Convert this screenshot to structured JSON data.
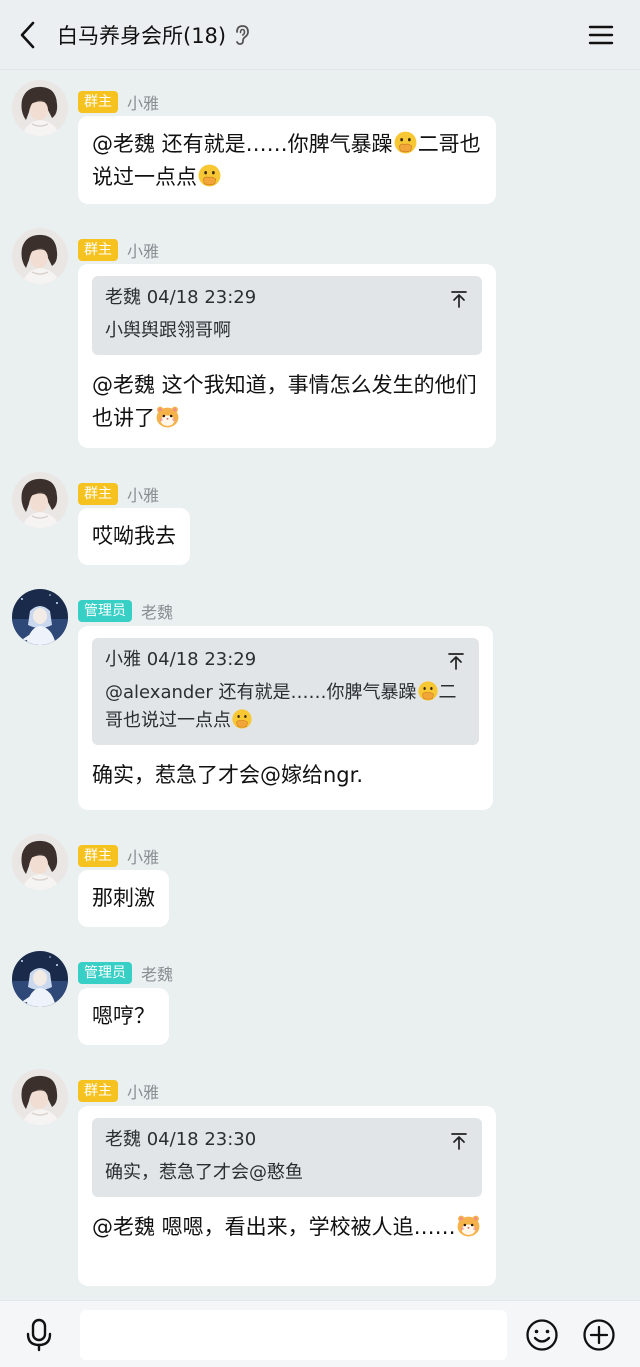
{
  "header": {
    "title": "白马养身会所(18)"
  },
  "messages": [
    {
      "sender": "小雅",
      "badge": "群主",
      "text": "@老魏 还有就是……你脾气暴躁",
      "text_emoji": "hand-over-mouth",
      "text2": "二哥也说过一点点",
      "text2_emoji": "hand-over-mouth"
    },
    {
      "sender": "小雅",
      "badge": "群主",
      "quote": {
        "author": "老魏",
        "time": "04/18 23:29",
        "text": "小舆舆跟翎哥啊"
      },
      "text": "@老魏 这个我知道，事情怎么发生的他们也讲了",
      "text_emoji": "hamster"
    },
    {
      "sender": "小雅",
      "badge": "群主",
      "text": "哎呦我去"
    },
    {
      "sender": "老魏",
      "badge": "管理员",
      "quote": {
        "author": "小雅",
        "time": "04/18 23:29",
        "text": "@alexander 还有就是……你脾气暴躁",
        "text_emoji": "hand-over-mouth",
        "text2": "二哥也说过一点点",
        "text2_emoji": "hand-over-mouth"
      },
      "text": "确实，惹急了才会@嫁给ngr."
    },
    {
      "sender": "小雅",
      "badge": "群主",
      "text": "那刺激"
    },
    {
      "sender": "老魏",
      "badge": "管理员",
      "text": "嗯哼？"
    },
    {
      "sender": "小雅",
      "badge": "群主",
      "quote": {
        "author": "老魏",
        "time": "04/18 23:30",
        "text": "确实，惹急了才会@憨鱼"
      },
      "text": "@老魏 嗯嗯，看出来，学校被人追……",
      "text_emoji": "hamster"
    }
  ],
  "input": {
    "placeholder": ""
  },
  "colors": {
    "owner_badge": "#f6c21f",
    "admin_badge": "#38cfc6",
    "background": "#eaeff0",
    "bubble": "#ffffff",
    "quote_bg": "#e2e5e8"
  }
}
